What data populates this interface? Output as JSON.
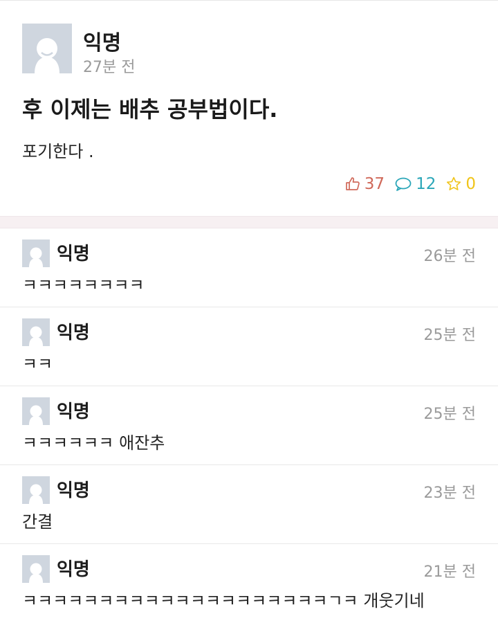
{
  "post": {
    "author": "익명",
    "time": "27분 전",
    "title": "후 이제는 배추 공부법이다.",
    "body": "포기한다 .",
    "likes": "37",
    "comments": "12",
    "scraps": "0",
    "colors": {
      "like": "#d0695a",
      "comment": "#2aa6b8",
      "scrap": "#f0c419"
    }
  },
  "comments": [
    {
      "author": "익명",
      "time": "26분 전",
      "text": "ㅋㅋㅋㅋㅋㅋㅋㅋ"
    },
    {
      "author": "익명",
      "time": "25분 전",
      "text": "ㅋㅋ"
    },
    {
      "author": "익명",
      "time": "25분 전",
      "text": "ㅋㅋㅋㅋㅋㅋ 애잔추"
    },
    {
      "author": "익명",
      "time": "23분 전",
      "text": "간결"
    },
    {
      "author": "익명",
      "time": "21분 전",
      "text": "ㅋㅋㅋㅋㅋㅋㅋㅋㅋㅋㅋㅋㅋㅋㅋㅋㅋㅋㅋㅋㄱㅋ 개웃기네"
    }
  ]
}
